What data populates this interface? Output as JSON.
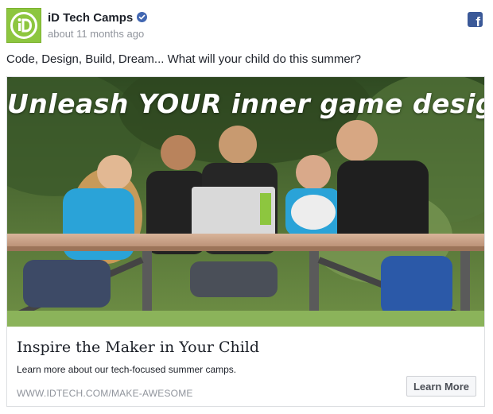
{
  "page": {
    "name": "iD Tech Camps",
    "avatar_text": "iD",
    "timestamp": "about 11 months ago",
    "verified_icon": "verified-badge-icon",
    "network_icon": "facebook-icon",
    "network_icon_glyph": "f"
  },
  "post": {
    "text": "Code, Design, Build, Dream... What will your child do this summer?"
  },
  "link_card": {
    "image_headline": "Unleash YOUR inner game designer!",
    "title": "Inspire the Maker in Your Child",
    "description": "Learn more about our tech-focused summer camps.",
    "domain": "WWW.IDTECH.COM/MAKE-AWESOME",
    "cta_label": "Learn More"
  },
  "colors": {
    "brand_green": "#8dc63f",
    "facebook_blue": "#3b5998",
    "verified_blue": "#4267b2",
    "meta_gray": "#90949c"
  }
}
